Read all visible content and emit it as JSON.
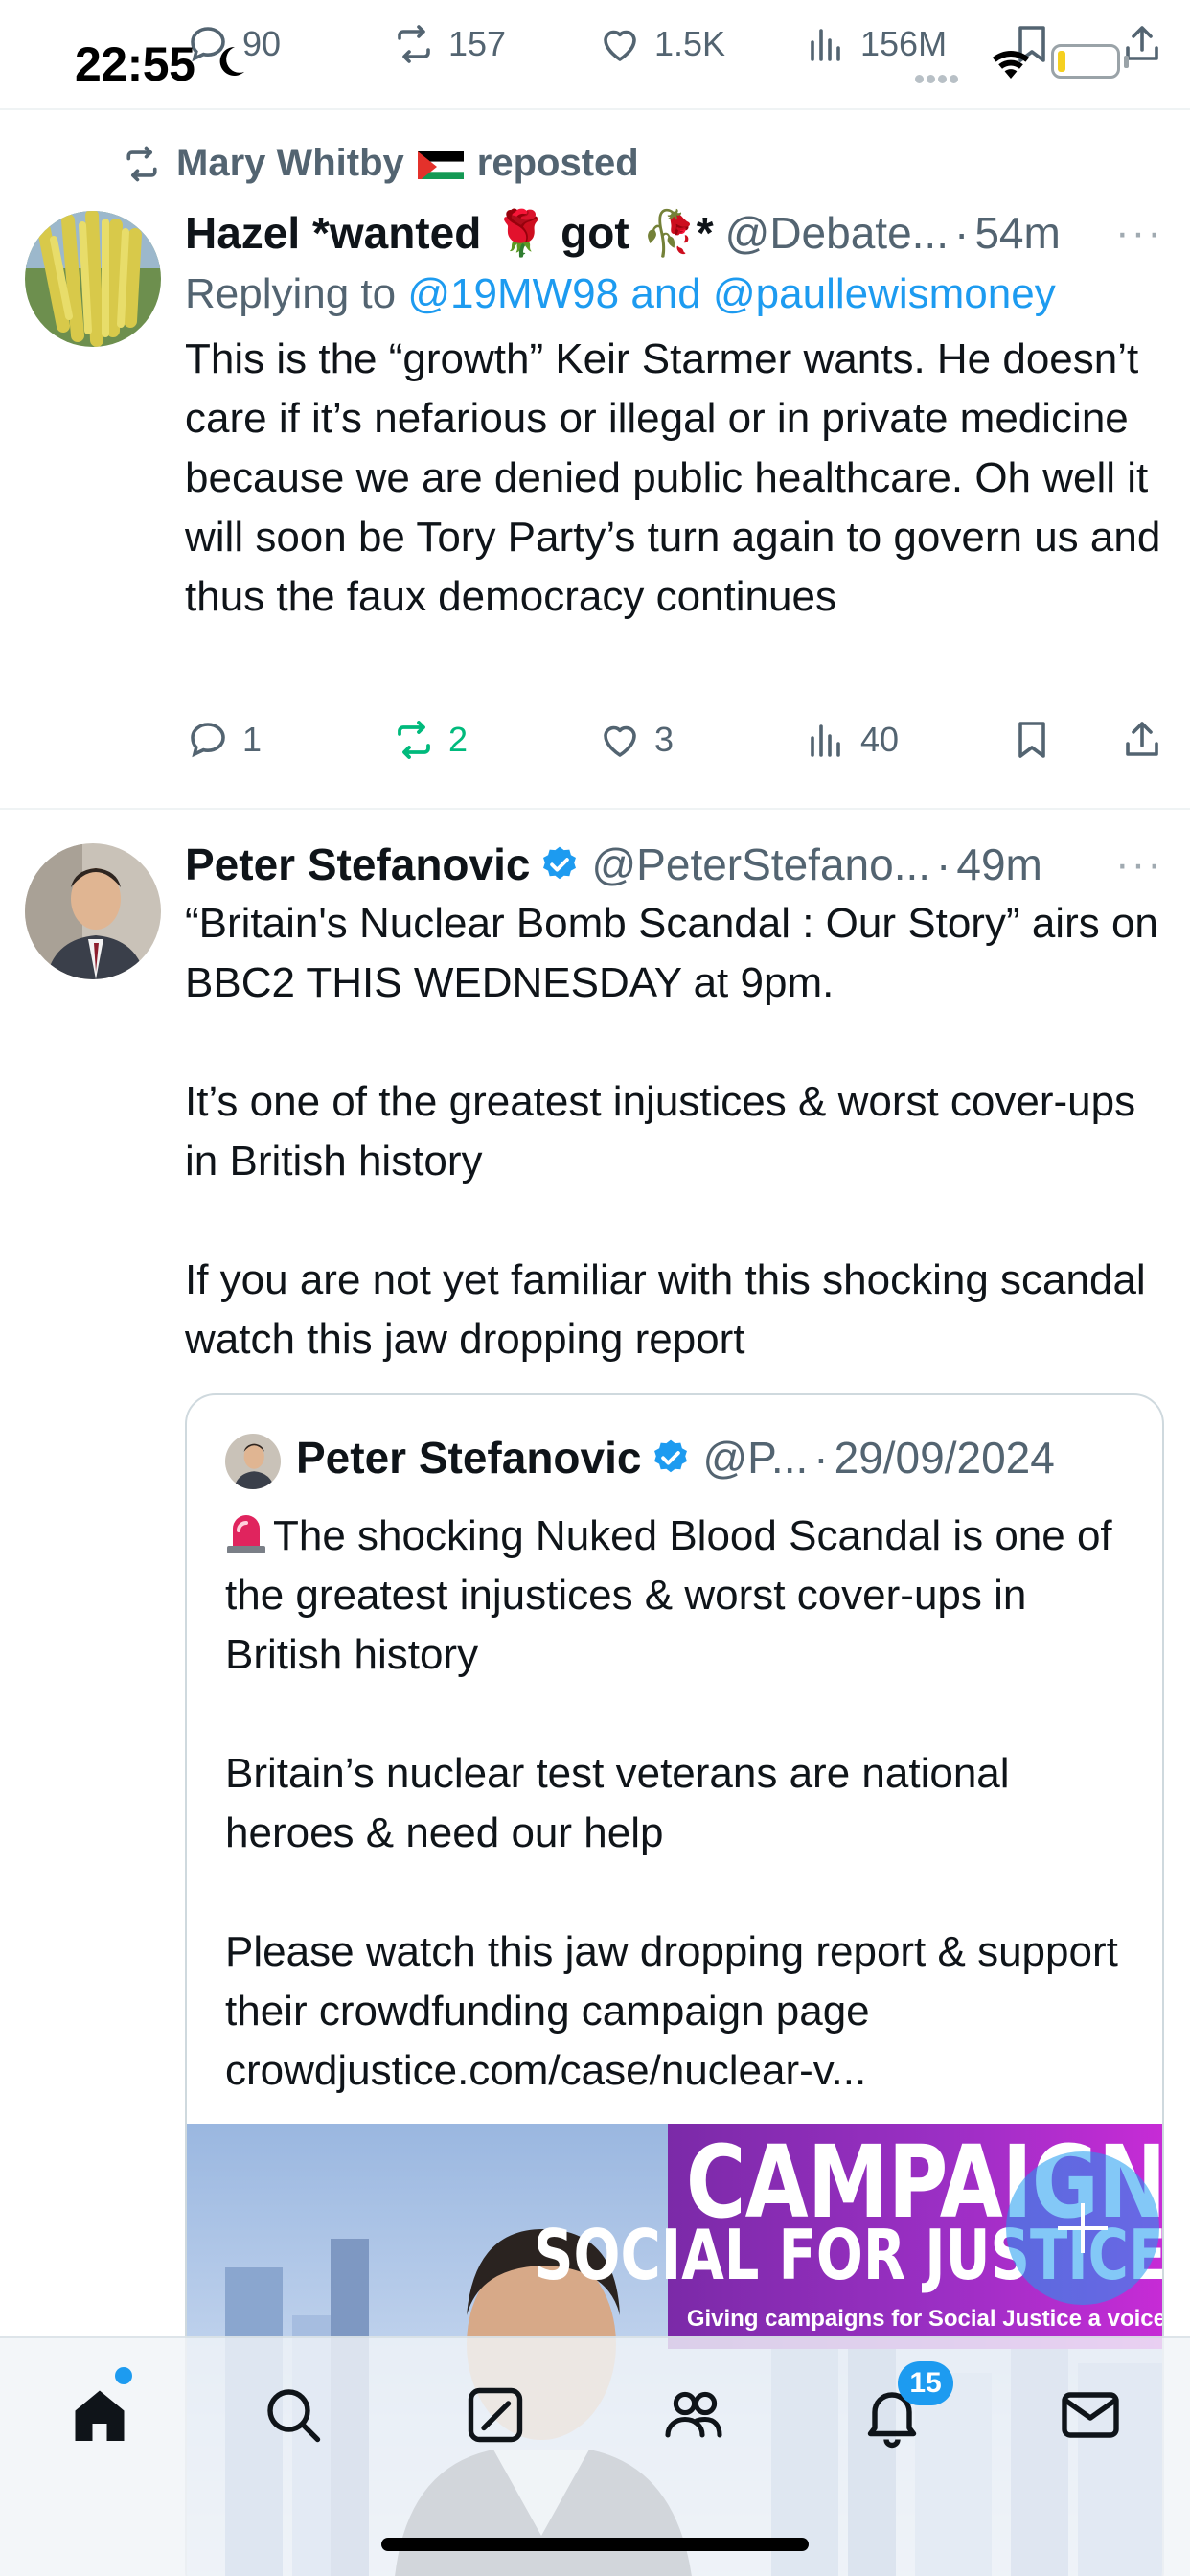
{
  "status_bar": {
    "time": "22:55"
  },
  "prev_tweet_actions": {
    "replies": "90",
    "reposts": "157",
    "likes": "1.5K",
    "views": "156M"
  },
  "tweets": [
    {
      "repost_by": "Mary Whitby",
      "repost_label": "reposted",
      "author_name": "Hazel *wanted 🌹 got 🥀*",
      "author_handle": "@Debate...",
      "time": "54m",
      "more": "···",
      "reply_prefix": "Replying to",
      "reply_to_1": "@19MW98",
      "reply_and": "and",
      "reply_to_2": "@paullewismoney",
      "text": "This is the “growth” Keir Starmer wants. He doesn’t care if it’s nefarious or illegal or in private medicine because we are denied public healthcare. Oh well it will soon be Tory Party’s turn again to govern us and thus the faux democracy continues",
      "replies": "1",
      "reposts": "2",
      "likes": "3",
      "views": "40"
    },
    {
      "author_name": "Peter Stefanovic",
      "author_handle": "@PeterStefano...",
      "time": "49m",
      "more": "···",
      "text": "“Britain's Nuclear Bomb Scandal : Our Story” airs on BBC2 THIS WEDNESDAY at 9pm.\n\nIt’s one of the greatest injustices & worst cover-ups in British history\n\nIf you are not yet familiar with this shocking scandal watch this jaw dropping report",
      "quote": {
        "author_name": "Peter Stefanovic",
        "author_handle": "@P...",
        "date": "29/09/2024",
        "text": "The shocking Nuked Blood Scandal is one of the greatest injustices & worst cover-ups in British history\n\nBritain’s nuclear test veterans are national heroes & need our help\n\nPlease watch this jaw dropping report & support their crowdfunding campaign page crowdjustice.com/case/nuclear-v...",
        "media_banner_line1": "CAMPAIGN",
        "media_banner_line2": "SOCIAL FOR JUSTICE",
        "media_banner_line3": "Giving campaigns for Social Justice a voice"
      }
    }
  ],
  "tab_bar": {
    "notifications_badge": "15",
    "tabs": [
      "home",
      "search",
      "grok",
      "communities",
      "notifications",
      "messages"
    ]
  },
  "colors": {
    "accent": "#1d9bf0",
    "repost_active": "#00ba7c",
    "secondary_text": "#536471"
  }
}
